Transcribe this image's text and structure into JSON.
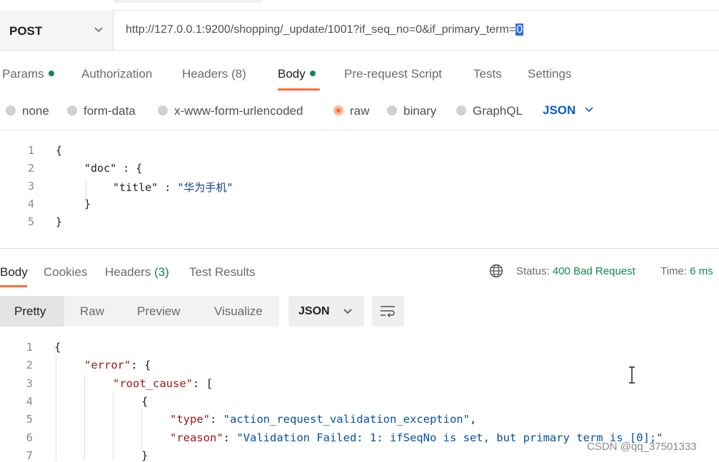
{
  "request": {
    "method": "POST",
    "url_prefix": "http://127.0.0.1:9200/shopping/_update/1001?if_seq_no=0&if_primary_term=",
    "url_selected": "0"
  },
  "request_tabs": [
    {
      "label": "Params"
    },
    {
      "label": "Authorization"
    },
    {
      "label": "Headers (8)"
    },
    {
      "label": "Body"
    },
    {
      "label": "Pre-request Script"
    },
    {
      "label": "Tests"
    },
    {
      "label": "Settings"
    }
  ],
  "body_options": {
    "none": "none",
    "form_data": "form-data",
    "urlencoded": "x-www-form-urlencoded",
    "raw": "raw",
    "binary": "binary",
    "graphql": "GraphQL",
    "language": "JSON"
  },
  "request_body": {
    "line_numbers": [
      "1",
      "2",
      "3",
      "4",
      "5"
    ],
    "l1": "{",
    "l2_key": "\"doc\"",
    "l2_rest": " : {",
    "l3_key": "\"title\"",
    "l3_mid": " : ",
    "l3_val": "\"华为手机\"",
    "l4": "}",
    "l5": "}"
  },
  "response_tabs": {
    "body": "Body",
    "cookies": "Cookies",
    "headers": "Headers",
    "headers_count": "(3)",
    "test_results": "Test Results"
  },
  "status": {
    "status_label": "Status:",
    "status_value": "400 Bad Request",
    "time_label": "Time:",
    "time_value": "6 ms"
  },
  "view_modes": [
    "Pretty",
    "Raw",
    "Preview",
    "Visualize"
  ],
  "response_format": "JSON",
  "response_body": {
    "line_numbers": [
      "1",
      "2",
      "3",
      "4",
      "5",
      "6",
      "7"
    ],
    "l1": "{",
    "l2_key": "\"error\"",
    "l2_rest": ": {",
    "l3_key": "\"root_cause\"",
    "l3_rest": ": [",
    "l4": "{",
    "l5_key": "\"type\"",
    "l5_mid": ": ",
    "l5_val": "\"action_request_validation_exception\"",
    "l5_end": ",",
    "l6_key": "\"reason\"",
    "l6_mid": ": ",
    "l6_val": "\"Validation Failed: 1: ifSeqNo is set, but primary term is [0];\"",
    "l7": "}"
  },
  "watermark": "CSDN @qq_37501333"
}
